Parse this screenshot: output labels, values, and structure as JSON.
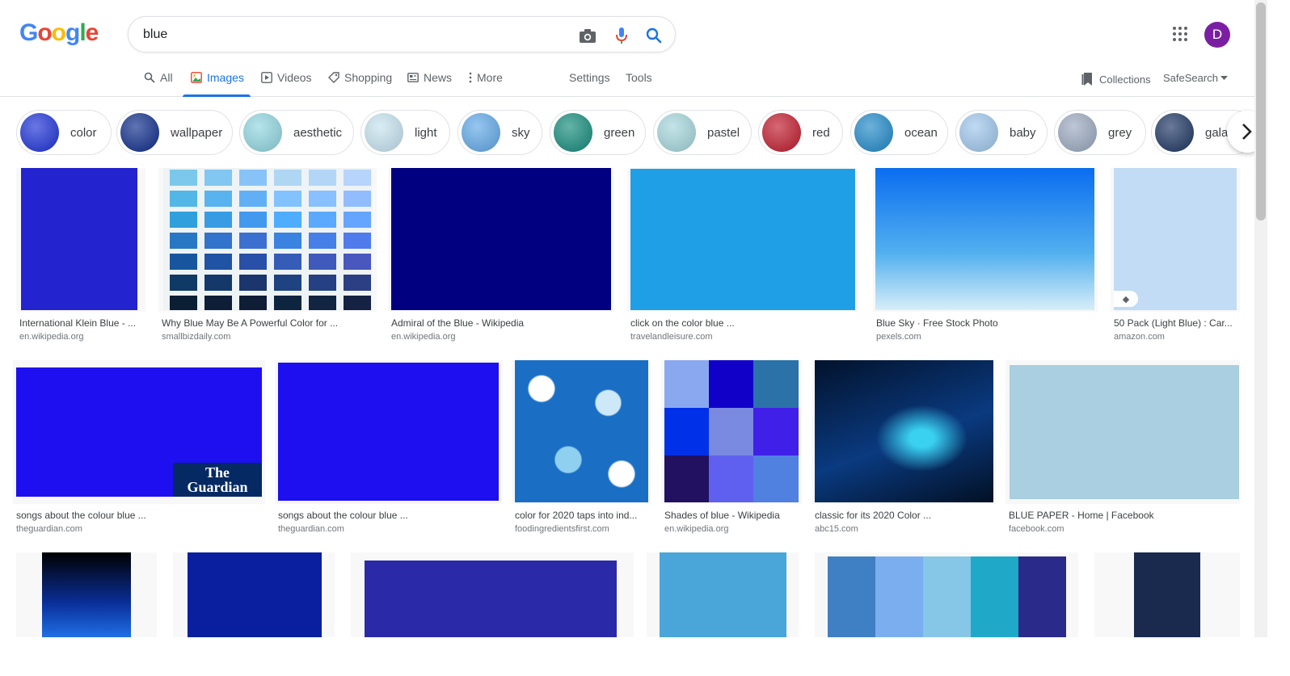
{
  "search": {
    "query": "blue"
  },
  "header": {
    "avatar_letter": "D"
  },
  "tabs": [
    {
      "label": "All"
    },
    {
      "label": "Images"
    },
    {
      "label": "Videos"
    },
    {
      "label": "Shopping"
    },
    {
      "label": "News"
    },
    {
      "label": "More"
    }
  ],
  "tools": {
    "settings": "Settings",
    "tools": "Tools",
    "collections": "Collections",
    "safesearch": "SafeSearch"
  },
  "chips": [
    {
      "label": "color",
      "color": "#1a2fd6"
    },
    {
      "label": "wallpaper",
      "color": "#0b2a8a"
    },
    {
      "label": "aesthetic",
      "color": "#8fd6e0"
    },
    {
      "label": "light",
      "color": "#c5e3f0"
    },
    {
      "label": "sky",
      "color": "#5fa8e8"
    },
    {
      "label": "green",
      "color": "#128a7a"
    },
    {
      "label": "pastel",
      "color": "#a4d6dc"
    },
    {
      "label": "red",
      "color": "#c0182a"
    },
    {
      "label": "ocean",
      "color": "#1e88c9"
    },
    {
      "label": "baby",
      "color": "#9dc6ec"
    },
    {
      "label": "grey",
      "color": "#9aa8bf"
    },
    {
      "label": "galaxy",
      "color": "#1a3360"
    }
  ],
  "results": [
    {
      "title": "International Klein Blue - ...",
      "source": "en.wikipedia.org",
      "color": "#2323d0"
    },
    {
      "title": "Why Blue May Be A Powerful Color for ...",
      "source": "smallbizdaily.com",
      "color": "#3aa8dc"
    },
    {
      "title": "Admiral of the Blue - Wikipedia",
      "source": "en.wikipedia.org",
      "color": "#000080"
    },
    {
      "title": "click on the color blue ...",
      "source": "travelandleisure.com",
      "color": "#1e9fe6"
    },
    {
      "title": "Blue Sky · Free Stock Photo",
      "source": "pexels.com",
      "color": "#2b88e8"
    },
    {
      "title": "50 Pack (Light Blue) : Car...",
      "source": "amazon.com",
      "color": "#c2dcf5"
    },
    {
      "title": "songs about the colour blue ...",
      "source": "theguardian.com",
      "color": "#1d0ff0",
      "badge": "The Guardian"
    },
    {
      "title": "songs about the colour blue ...",
      "source": "theguardian.com",
      "color": "#1d0ff0"
    },
    {
      "title": "color for 2020 taps into ind...",
      "source": "foodingredientsfirst.com",
      "color": "#3a8ed6"
    },
    {
      "title": "Shades of blue - Wikipedia",
      "source": "en.wikipedia.org",
      "color": "#3b3fd8"
    },
    {
      "title": "classic for its 2020 Color ...",
      "source": "abc15.com",
      "color": "#0a2a60"
    },
    {
      "title": "BLUE PAPER - Home | Facebook",
      "source": "facebook.com",
      "color": "#a9cfe0"
    },
    {
      "title": "",
      "source": "",
      "color": "#0a2f9a"
    },
    {
      "title": "",
      "source": "",
      "color": "#0a1fa0"
    },
    {
      "title": "",
      "source": "",
      "color": "#2a2aa8"
    },
    {
      "title": "",
      "source": "",
      "color": "#4aa6d8"
    },
    {
      "title": "",
      "source": "",
      "color": "#3f7fc4"
    },
    {
      "title": "",
      "source": "",
      "color": "#1a2a4f"
    }
  ]
}
